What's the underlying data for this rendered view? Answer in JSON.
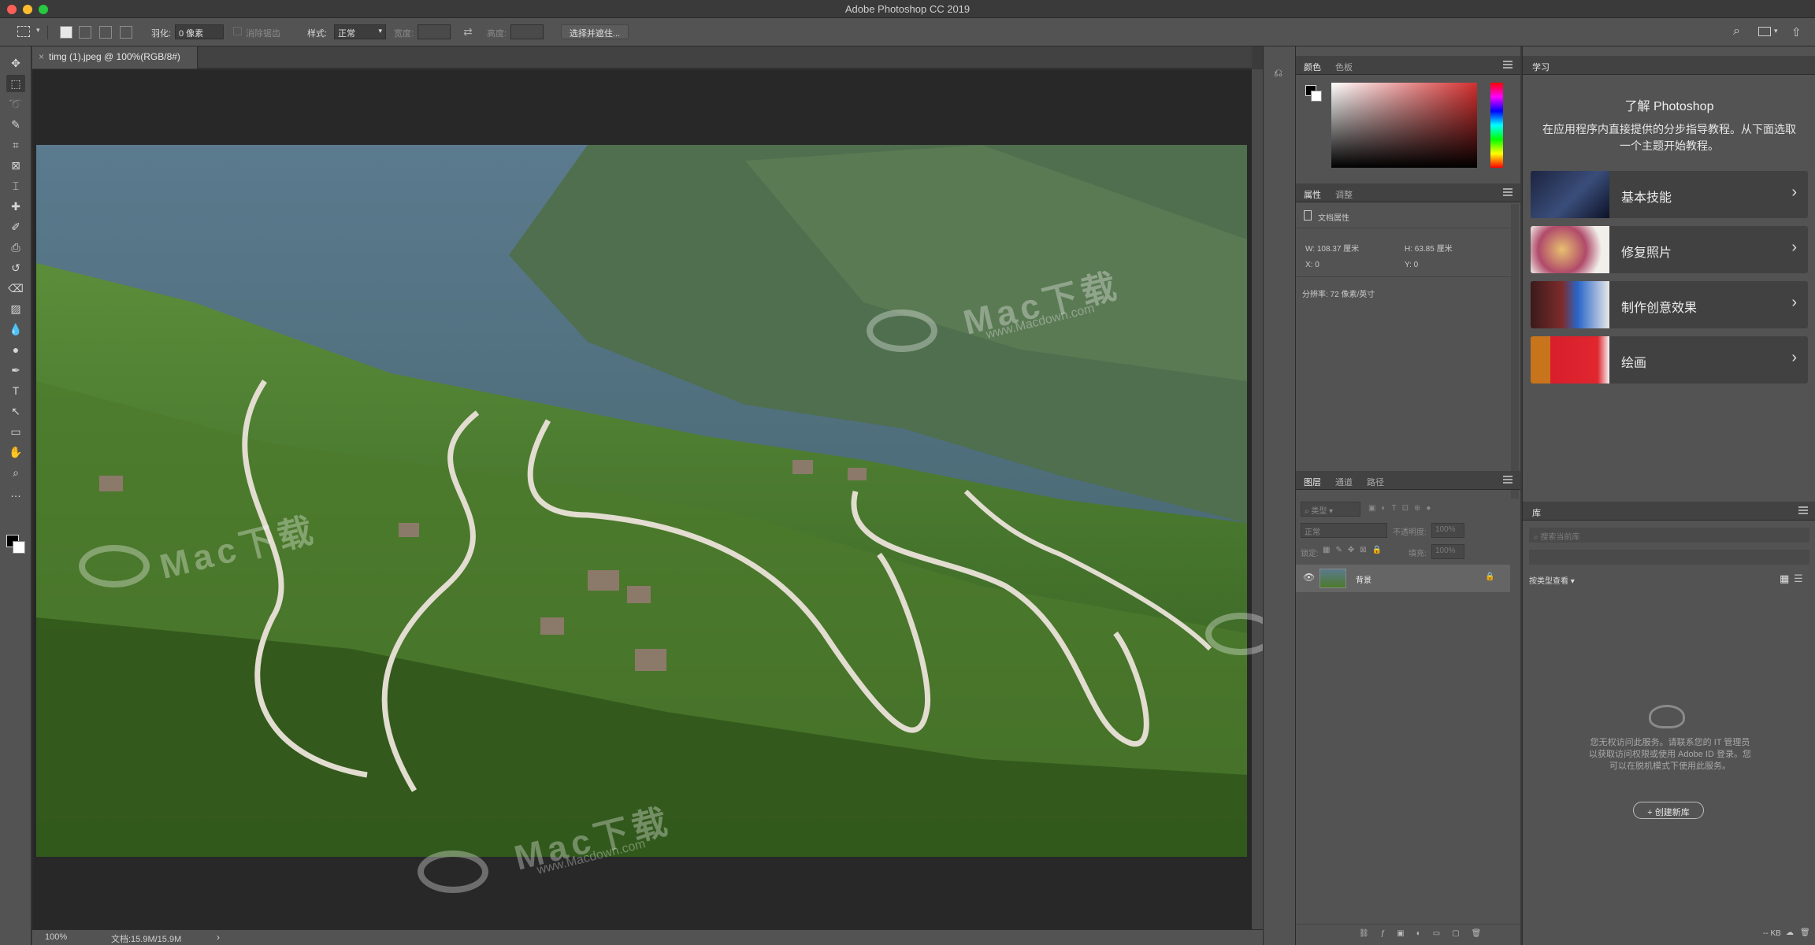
{
  "app_title": "Adobe Photoshop CC 2019",
  "options_bar": {
    "feather_label": "羽化:",
    "feather_value": "0 像素",
    "antialias_label": "消除锯齿",
    "style_label": "样式:",
    "style_value": "正常",
    "width_label": "宽度:",
    "height_label": "高度:",
    "select_mask_button": "选择并遮住..."
  },
  "document_tab": {
    "title": "timg (1).jpeg @ 100%(RGB/8#)"
  },
  "status_bar": {
    "zoom": "100%",
    "doc_info": "文档:15.9M/15.9M"
  },
  "color_panel": {
    "tabs": [
      "颜色",
      "色板"
    ],
    "accent_color": "#d32f2f"
  },
  "properties_panel": {
    "tabs": [
      "属性",
      "调整"
    ],
    "doc_props_label": "文档属性",
    "width": "W: 108.37 厘米",
    "height": "H: 63.85 厘米",
    "x": "X: 0",
    "y": "Y: 0",
    "resolution": "分辨率: 72 像素/英寸"
  },
  "layers_panel": {
    "tabs": [
      "图层",
      "通道",
      "路径"
    ],
    "filter_placeholder": "类型",
    "blend_mode": "正常",
    "opacity_label": "不透明度:",
    "opacity_value": "100%",
    "lock_label": "锁定:",
    "fill_label": "填充:",
    "fill_value": "100%",
    "layer_name": "背景"
  },
  "learn_panel": {
    "tab": "学习",
    "heading": "了解 Photoshop",
    "desc": "在应用程序内直接提供的分步指导教程。从下面选取一个主题开始教程。",
    "topics": [
      "基本技能",
      "修复照片",
      "制作创意效果",
      "绘画"
    ]
  },
  "library_panel": {
    "tab": "库",
    "search_placeholder": "搜索当前库",
    "view_by": "按类型查看",
    "message": "您无权访问此服务。请联系您的 IT 管理员以获取访问权限或使用 Adobe ID 登录。您可以在脱机模式下使用此服务。",
    "create_button": "+ 创建新库",
    "size": "-- KB"
  },
  "watermark": {
    "text": "Mac下载",
    "url": "www.Macdown.com"
  },
  "icons": [
    "move-icon",
    "marquee-icon",
    "lasso-icon",
    "quick-select-icon",
    "crop-icon",
    "frame-icon",
    "eyedropper-icon",
    "healing-icon",
    "brush-icon",
    "stamp-icon",
    "history-brush-icon",
    "eraser-icon",
    "gradient-icon",
    "blur-icon",
    "dodge-icon",
    "pen-icon",
    "type-icon",
    "path-select-icon",
    "rectangle-icon",
    "hand-icon",
    "zoom-icon",
    "more-icon"
  ]
}
